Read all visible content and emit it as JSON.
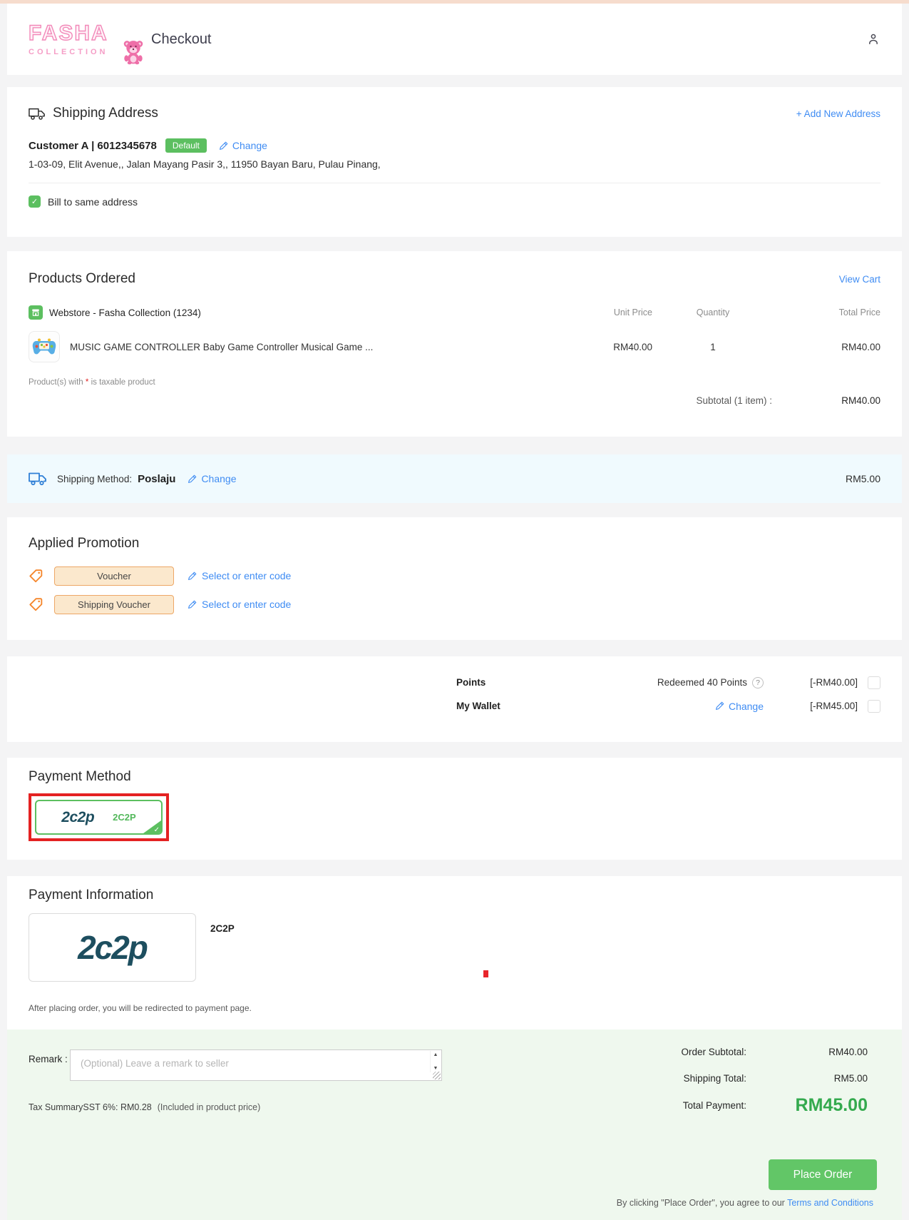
{
  "colors": {
    "link_blue": "#3f8cf3",
    "success_green": "#5cbf60",
    "brand_pink": "#f28ab9",
    "accent_orange": "#f5862b",
    "highlight_red": "#e42222",
    "teal_2c2p": "#1d4e5f",
    "total_green": "#34aa4e"
  },
  "header": {
    "brand_line1": "FASHA",
    "brand_line2": "COLLECTION",
    "title": "Checkout"
  },
  "shipping_address": {
    "title": "Shipping Address",
    "add_new_label": "+ Add New Address",
    "customer": "Customer A | 6012345678",
    "default_badge": "Default",
    "change_label": "Change",
    "address": "1-03-09, Elit Avenue,, Jalan Mayang Pasir 3,, 11950 Bayan Baru, Pulau Pinang,",
    "bill_to_same": "Bill to same address"
  },
  "products": {
    "title": "Products Ordered",
    "view_cart_label": "View Cart",
    "store_name": "Webstore - Fasha Collection (1234)",
    "col_unit_price": "Unit Price",
    "col_quantity": "Quantity",
    "col_total_price": "Total Price",
    "items": [
      {
        "name": "MUSIC GAME CONTROLLER Baby Game Controller Musical Game ...",
        "unit_price": "RM40.00",
        "quantity": "1",
        "total_price": "RM40.00"
      }
    ],
    "tax_note_prefix": "Product(s) with ",
    "tax_note_star": "*",
    "tax_note_suffix": " is taxable product",
    "subtotal_label": "Subtotal (1 item) :",
    "subtotal_value": "RM40.00"
  },
  "shipping_method": {
    "label": "Shipping Method:",
    "value": "Poslaju",
    "change_label": "Change",
    "price": "RM5.00"
  },
  "promotion": {
    "title": "Applied Promotion",
    "rows": [
      {
        "button_label": "Voucher",
        "link_label": "Select or enter code"
      },
      {
        "button_label": "Shipping Voucher",
        "link_label": "Select or enter code"
      }
    ]
  },
  "rewards": {
    "points_label": "Points",
    "points_status": "Redeemed 40 Points",
    "points_amount": "[-RM40.00]",
    "wallet_label": "My Wallet",
    "wallet_change_label": "Change",
    "wallet_amount": "[-RM45.00]"
  },
  "payment_method": {
    "title": "Payment Method",
    "logo_text": "2c2p",
    "option_label": "2C2P"
  },
  "payment_info": {
    "title": "Payment Information",
    "logo_text": "2c2p",
    "name": "2C2P",
    "note": "After placing order, you will be redirected to payment page."
  },
  "footer": {
    "remark_label": "Remark :",
    "remark_placeholder": "(Optional) Leave a remark to seller",
    "tax_summary_label": "Tax Summary",
    "tax_sst": "SST 6%: RM0.28",
    "tax_included": "(Included in product price)",
    "order_subtotal_label": "Order Subtotal:",
    "order_subtotal_value": "RM40.00",
    "shipping_total_label": "Shipping Total:",
    "shipping_total_value": "RM5.00",
    "total_payment_label": "Total Payment:",
    "total_payment_value": "RM45.00",
    "place_order_label": "Place Order",
    "terms_prefix": "By clicking \"Place Order\", you agree to our ",
    "terms_link_label": "Terms and Conditions"
  }
}
